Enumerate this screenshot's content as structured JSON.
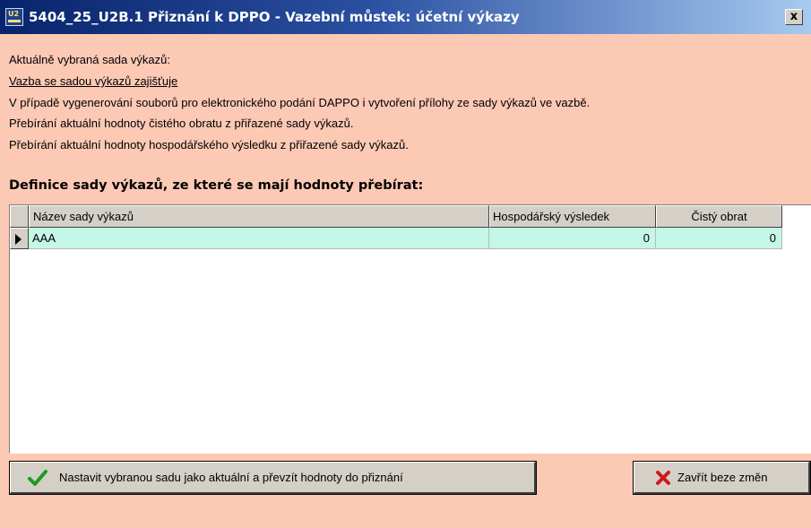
{
  "window": {
    "title": "5404_25_U2B.1 Přiznání k DPPO - Vazební můstek: účetní výkazy",
    "close_label": "x"
  },
  "info": {
    "line1": "Aktuálně vybraná sada výkazů:",
    "line2": "Vazba se sadou výkazů zajišťuje",
    "line3": "V případě vygenerování souborů pro elektronického podání DAPPO i vytvoření přílohy ze sady výkazů ve vazbě.",
    "line4": "Přebírání aktuální hodnoty čistého obratu z přiřazené sady výkazů.",
    "line5": "Přebírání aktuální hodnoty hospodářského výsledku z přiřazené sady výkazů."
  },
  "section": {
    "title": "Definice sady výkazů, ze které se mají hodnoty přebírat:"
  },
  "grid": {
    "columns": [
      "Název sady výkazů",
      "Hospodářský výsledek",
      "Čistý obrat"
    ],
    "rows": [
      {
        "name": "AAA",
        "result": "0",
        "turnover": "0"
      }
    ]
  },
  "buttons": {
    "apply_label": "Nastavit vybranou sadu jako aktuální a převzít hodnoty do přiznání",
    "close_label": "Zavřít beze změn"
  },
  "colors": {
    "background": "#fcc9b5",
    "selected_row": "#c4f7e5",
    "title_bar": "#08246b"
  },
  "icons": {
    "apply": "check-icon",
    "close": "x-icon"
  }
}
